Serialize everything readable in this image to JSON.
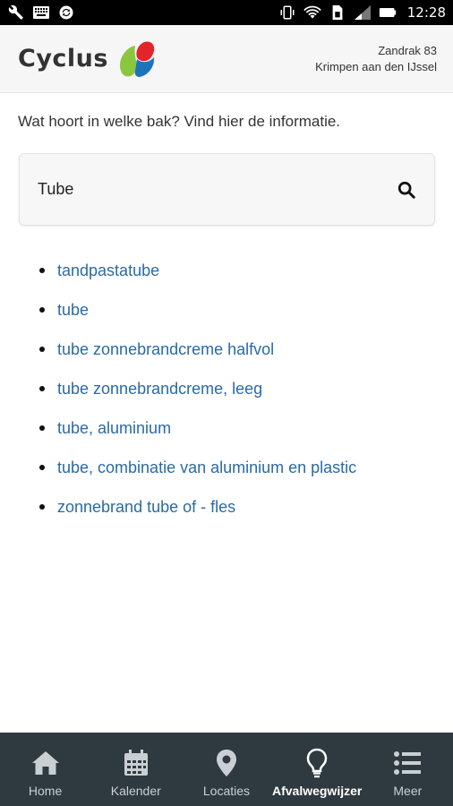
{
  "status_bar": {
    "time": "12:28",
    "left_icons": [
      "wrench-icon",
      "keyboard-icon",
      "sync-icon"
    ],
    "right_icons": [
      "vibrate-icon",
      "wifi-icon",
      "sim-icon",
      "signal-icon",
      "battery-icon"
    ]
  },
  "header": {
    "brand": "Cyclus",
    "address_line1": "Zandrak 83",
    "address_line2": "Krimpen aan den IJssel"
  },
  "main": {
    "intro": "Wat hoort in welke bak? Vind hier de informatie.",
    "search": {
      "value": "Tube"
    },
    "results": [
      "tandpastatube",
      "tube",
      "tube zonnebrandcreme halfvol",
      "tube zonnebrandcreme, leeg",
      "tube, aluminium",
      "tube, combinatie van aluminium en plastic",
      "zonnebrand tube of - fles"
    ]
  },
  "bottom_nav": {
    "items": [
      {
        "label": "Home",
        "icon": "home-icon"
      },
      {
        "label": "Kalender",
        "icon": "calendar-icon"
      },
      {
        "label": "Locaties",
        "icon": "location-pin-icon"
      },
      {
        "label": "Afvalwegwijzer",
        "icon": "lightbulb-icon",
        "active": true
      },
      {
        "label": "Meer",
        "icon": "list-icon"
      }
    ]
  },
  "colors": {
    "link": "#2a6aa6",
    "nav_background": "#2f3a40",
    "header_background": "#f6f6f6",
    "logo_red": "#e3242b",
    "logo_green": "#8cc63f",
    "logo_blue": "#1c75bc"
  }
}
